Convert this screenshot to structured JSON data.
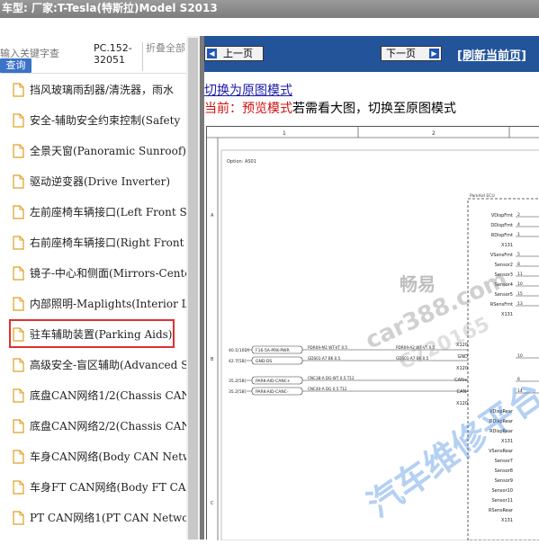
{
  "header": {
    "title": "车型:  厂家:T-Tesla(特斯拉)Model S2013"
  },
  "toolbar": {
    "search_placeholder": "输入关键字查",
    "query_label": "查询",
    "pc_code": "PC.152-32051",
    "fold_all_label": "折叠全部"
  },
  "tree": {
    "items": [
      {
        "label": "挡风玻璃雨刮器/清洗器，雨水"
      },
      {
        "label": "安全-辅助安全约束控制(Safety"
      },
      {
        "label": "全景天窗(Panoramic Sunroof)"
      },
      {
        "label": "驱动逆变器(Drive Inverter)"
      },
      {
        "label": "左前座椅车辆接口(Left Front S"
      },
      {
        "label": "右前座椅车辆接口(Right Front"
      },
      {
        "label": "镜子-中心和侧面(Mirrors-Cente"
      },
      {
        "label": "内部照明-Maplights(Interior Li"
      },
      {
        "label": "驻车辅助装置(Parking Aids)"
      },
      {
        "label": "高级安全-盲区辅助(Advanced S"
      },
      {
        "label": "底盘CAN网络1/2(Chassis CAN"
      },
      {
        "label": "底盘CAN网络2/2(Chassis CAN"
      },
      {
        "label": "车身CAN网络(Body CAN Netw"
      },
      {
        "label": "车身FT CAN网络(Body FT CA"
      },
      {
        "label": "PT CAN网络1(PT CAN Network"
      }
    ],
    "selected_index": 8
  },
  "viewer": {
    "prev_label": "上一页",
    "next_label": "下一页",
    "refresh_label": "[刷新当前页]",
    "orig_link": "切换为原图模式",
    "preview_prefix": "当前：预览模式",
    "preview_suffix": "若需看大图，切换至原图模式"
  },
  "diagram": {
    "col_labels": [
      "1",
      "2"
    ],
    "row_labels": [
      "A",
      "B",
      "C"
    ],
    "option_label": "Option: AS01",
    "ecu_label": "ParkAid ECU",
    "right_pins": [
      {
        "name": "VDispFmt",
        "pin": "2"
      },
      {
        "name": "DDispFmt",
        "pin": "4"
      },
      {
        "name": "RDispFmt",
        "pin": "1"
      },
      {
        "name": "X131",
        "pin": ""
      },
      {
        "name": "VSensFmt",
        "pin": "5"
      },
      {
        "name": "Sensor2",
        "pin": "8"
      },
      {
        "name": "Sensor3",
        "pin": "11"
      },
      {
        "name": "Sensor4",
        "pin": "10"
      },
      {
        "name": "Sensor5",
        "pin": "15"
      },
      {
        "name": "RSensFmt",
        "pin": "13"
      },
      {
        "name": "X131",
        "pin": ""
      }
    ],
    "mid_pins": [
      {
        "name": "X120",
        "pin": ""
      },
      {
        "name": "GND",
        "pin": "10"
      },
      {
        "name": "X120",
        "pin": ""
      },
      {
        "name": "CAN+",
        "pin": "6"
      },
      {
        "name": "CAN-",
        "pin": "14"
      },
      {
        "name": "X120",
        "pin": ""
      }
    ],
    "lower_pins": [
      {
        "name": "VDispRear",
        "pin": ""
      },
      {
        "name": "DDispRear",
        "pin": ""
      },
      {
        "name": "RDispRear",
        "pin": ""
      },
      {
        "name": "X131",
        "pin": ""
      },
      {
        "name": "VSensRear",
        "pin": ""
      },
      {
        "name": "Sensor7",
        "pin": ""
      },
      {
        "name": "Sensor8",
        "pin": ""
      },
      {
        "name": "Sensor9",
        "pin": ""
      },
      {
        "name": "Sensor10",
        "pin": ""
      },
      {
        "name": "Sensor11",
        "pin": ""
      },
      {
        "name": "RSensRear",
        "pin": ""
      },
      {
        "name": "X131",
        "pin": ""
      }
    ],
    "wires": [
      {
        "left": "40.1[10D]",
        "box": "F16-5A-PRK-PWR",
        "wire": "PDR09-M2 WT-VT 0.5",
        "right": "PDR09-A2 WT-VT 0.5"
      },
      {
        "left": "42.7[5B]",
        "box": "GND-DS",
        "wire": "GDS01-A7 BK 0.5",
        "right": "GDS01-A7 BK 0.5"
      },
      {
        "left": "35.2[5B]",
        "box": "PARK-AID-CANC+",
        "wire": "CNC38-A DG-WT 0.5 T12",
        "right": ""
      },
      {
        "left": "35.2[5B]",
        "box": "PARK-AID-CANC-",
        "wire": "CNC40-A DG 0.5 T12",
        "right": ""
      }
    ]
  },
  "watermarks": [
    "畅易",
    "car388.com",
    "C720165",
    "汽车维修平台"
  ]
}
